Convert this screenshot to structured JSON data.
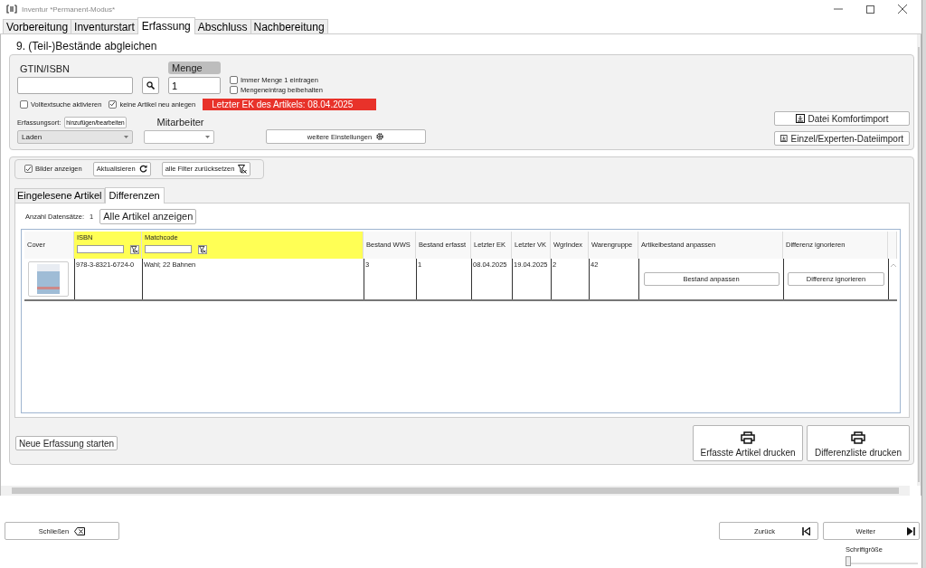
{
  "window": {
    "title": "Inventur *Permanent-Modus*"
  },
  "tabs": [
    {
      "label": "Vorbereitung",
      "selected": false
    },
    {
      "label": "Inventurstart",
      "selected": false
    },
    {
      "label": "Erfassung",
      "selected": true
    },
    {
      "label": "Abschluss",
      "selected": false
    },
    {
      "label": "Nachbereitung",
      "selected": false
    }
  ],
  "section_title": "9. (Teil-)Bestände abgleichen",
  "capture": {
    "gtin_label": "GTIN/ISBN",
    "quantity_label": "Menge",
    "quantity_value": "1",
    "options": [
      {
        "label": "Immer Menge 1 eintragen",
        "checked": false
      },
      {
        "label": "Mengeneintrag beibehalten",
        "checked": false
      }
    ],
    "flags": [
      {
        "label": "Volltextsuche aktivieren",
        "checked": false
      },
      {
        "label": "keine Artikel neu anlegen",
        "checked": true
      }
    ],
    "notice": "Letzter EK des Artikels: 08.04.2025",
    "location_label": "Erfassungsort:",
    "location_edit_button": "hinzufügen/bearbeiten",
    "location_value": "Laden",
    "employee_label": "Mitarbeiter",
    "settings_button": "weitere Einstellungen",
    "import_buttons": [
      "Datei Komfortimport",
      "Einzel/Experten-Dateiimport"
    ]
  },
  "toolbar": {
    "show_images": {
      "label": "Bilder anzeigen",
      "checked": true
    },
    "refresh_button": "Aktualisieren",
    "reset_filters_button": "alle Filter zurücksetzen"
  },
  "subtabs": [
    {
      "label": "Eingelesene Artikel",
      "selected": false
    },
    {
      "label": "Differenzen",
      "selected": true
    }
  ],
  "record_count_label": "Anzahl Datensätze:",
  "record_count": "1",
  "show_all_button": "Alle Artikel anzeigen",
  "table": {
    "columns": [
      {
        "label": "Cover",
        "filter": false
      },
      {
        "label": "ISBN",
        "filter": true
      },
      {
        "label": "Matchcode",
        "filter": true
      },
      {
        "label": "Bestand WWS",
        "filter": false
      },
      {
        "label": "Bestand erfasst",
        "filter": false
      },
      {
        "label": "Letzter EK",
        "filter": false
      },
      {
        "label": "Letzter VK",
        "filter": false
      },
      {
        "label": "WgrIndex",
        "filter": false
      },
      {
        "label": "Warengruppe",
        "filter": false
      },
      {
        "label": "Artikelbestand anpassen",
        "filter": false
      },
      {
        "label": "Differenz ignorieren",
        "filter": false
      }
    ],
    "rows": [
      {
        "cells": [
          {
            "kind": "image"
          },
          {
            "kind": "text",
            "text": "978-3-8321-6724-0"
          },
          {
            "kind": "text",
            "text": "Wahl; 22 Bahnen"
          },
          {
            "kind": "text",
            "text": "3"
          },
          {
            "kind": "text",
            "text": "1"
          },
          {
            "kind": "text",
            "text": "08.04.2025"
          },
          {
            "kind": "text",
            "text": "19.04.2025"
          },
          {
            "kind": "text",
            "text": "2"
          },
          {
            "kind": "text",
            "text": "42"
          },
          {
            "kind": "button",
            "text": "Bestand anpassen"
          },
          {
            "kind": "button",
            "text": "Differenz ignorieren"
          }
        ]
      }
    ]
  },
  "footer": {
    "new_capture_button": "Neue Erfassung starten",
    "print_buttons": [
      "Erfasste Artikel drucken",
      "Differenzliste drucken"
    ]
  },
  "nav": {
    "close_button": "Schließen",
    "back_button": "Zurück",
    "next_button": "Weiter"
  },
  "font_size": {
    "label": "Schriftgröße",
    "level": 0
  }
}
